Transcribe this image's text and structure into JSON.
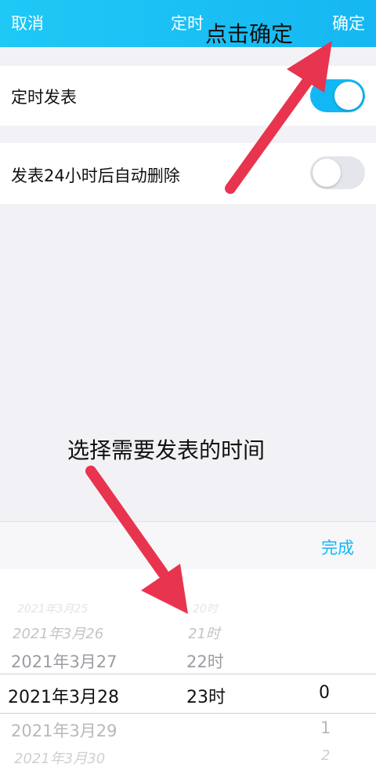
{
  "header": {
    "cancel": "取消",
    "title": "定时",
    "confirm": "确定"
  },
  "settings": {
    "scheduled_publish": {
      "label": "定时发表",
      "enabled": true
    },
    "auto_delete": {
      "label": "发表24小时后自动删除",
      "enabled": false
    }
  },
  "picker": {
    "done": "完成",
    "dates": [
      "2021年3月25",
      "2021年3月26",
      "2021年3月27",
      "2021年3月28",
      "2021年3月29",
      "2021年3月30"
    ],
    "hours": [
      "20时",
      "21时",
      "22时",
      "23时"
    ],
    "minutes": [
      "0",
      "1",
      "2"
    ],
    "selected": {
      "date": "2021年3月28",
      "hour": "23时",
      "minute": "0"
    }
  },
  "annotations": {
    "tap_confirm": "点击确定",
    "choose_time": "选择需要发表的时间"
  },
  "colors": {
    "accent": "#12b7f5",
    "arrow": "#e8344e"
  }
}
